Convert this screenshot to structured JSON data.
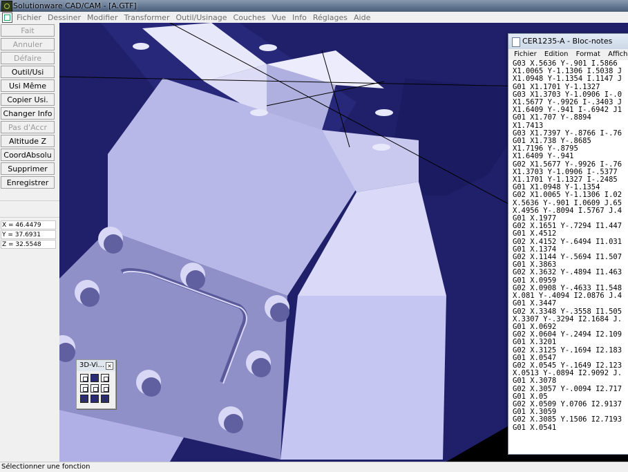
{
  "window": {
    "title": "Solutionware CAD/CAM - [A.GTF]"
  },
  "menubar": [
    "Fichier",
    "Dessiner",
    "Modifier",
    "Transformer",
    "Outil/Usinage",
    "Couches",
    "Vue",
    "Info",
    "Réglages",
    "Aide"
  ],
  "toolpanel": {
    "buttons": [
      {
        "label": "Fait",
        "disabled": true
      },
      {
        "label": "Annuler",
        "disabled": true
      },
      {
        "label": "Défaire",
        "disabled": true
      },
      {
        "label": "Outil/Usi",
        "disabled": false
      },
      {
        "label": "Usi Même",
        "disabled": false
      },
      {
        "label": "Copier Usi.",
        "disabled": false
      },
      {
        "label": "Changer Info",
        "disabled": false
      },
      {
        "label": "Pas d'Accr",
        "disabled": true
      },
      {
        "label": "Altitude Z",
        "disabled": false
      },
      {
        "label": "CoordAbsolu",
        "disabled": false
      },
      {
        "label": "Supprimer",
        "disabled": false
      },
      {
        "label": "Enregistrer",
        "disabled": false
      }
    ],
    "coords": {
      "x": "X = 46.4479",
      "y": "Y = 37.6931",
      "z": "Z = 32.5548"
    }
  },
  "view3d_panel": {
    "title": "3D-Vi...",
    "close": "×"
  },
  "notepad": {
    "title": "CER1235-A - Bloc-notes",
    "menu": [
      "Fichier",
      "Edition",
      "Format",
      "Affichage"
    ],
    "lines": [
      "G03 X.5636 Y-.901 I.5866",
      "X1.0065 Y-1.1306 I.5038 J",
      "X1.0948 Y-1.1354 I.1147 J",
      "G01 X1.1701 Y-1.1327",
      "G03 X1.3703 Y-1.0906 I-.0",
      "X1.5677 Y-.9926 I-.3403 J",
      "X1.6409 Y-.941 I-.6942 J1",
      "G01 X1.707 Y-.8894",
      "X1.7413",
      "G03 X1.7397 Y-.8766 I-.76",
      "G01 X1.738 Y-.8685",
      "X1.7196 Y-.8795",
      "X1.6409 Y-.941",
      "G02 X1.5677 Y-.9926 I-.76",
      "X1.3703 Y-1.0906 I-.5377",
      "X1.1701 Y-1.1327 I-.2485",
      "G01 X1.0948 Y-1.1354",
      "G02 X1.0065 Y-1.1306 I.02",
      "X.5636 Y-.901 I.0609 J.65",
      "X.4956 Y-.8094 I.5767 J.4",
      "G01 X.1977",
      "G02 X.1651 Y-.7294 I1.447",
      "G01 X.4512",
      "G02 X.4152 Y-.6494 I1.031",
      "G01 X.1374",
      "G02 X.1144 Y-.5694 I1.507",
      "G01 X.3863",
      "G02 X.3632 Y-.4894 I1.463",
      "G01 X.0959",
      "G02 X.0908 Y-.4633 I1.548",
      "X.081 Y-.4094 I2.0876 J.4",
      "G01 X.3447",
      "G02 X.3348 Y-.3558 I1.505",
      "X.3307 Y-.3294 I2.1684 J.",
      "G01 X.0692",
      "G02 X.0604 Y-.2494 I2.109",
      "G01 X.3201",
      "G02 X.3125 Y-.1694 I2.183",
      "G01 X.0547",
      "G02 X.0545 Y-.1649 I2.123",
      "X.0513 Y-.0894 I2.9092 J.",
      "G01 X.3078",
      "G02 X.3057 Y-.0094 I2.717",
      "G01 X.05",
      "G02 X.0509 Y.0706 I2.9137",
      "G01 X.3059",
      "G02 X.3085 Y.1506 I2.7193",
      "G01 X.0541"
    ]
  },
  "statusbar": {
    "text": "Sélectionner une fonction"
  }
}
